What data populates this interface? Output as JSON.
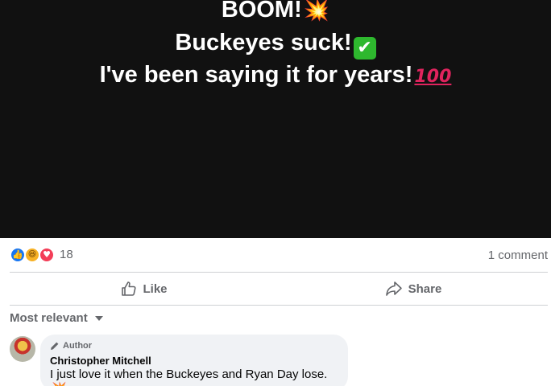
{
  "post": {
    "line1": "BOOM!",
    "line2": "Buckeyes suck!",
    "line3": "I've been saying it for years!",
    "emoji_boom": "💥",
    "emoji_check": "✔",
    "emoji_100": "100"
  },
  "reactions": {
    "count": "18",
    "icons": [
      "like-icon",
      "haha-icon",
      "love-icon"
    ],
    "comments_label": "1 comment"
  },
  "actions": {
    "like_label": "Like",
    "share_label": "Share"
  },
  "sort": {
    "label": "Most relevant"
  },
  "comment": {
    "badge": "Author",
    "name": "Christopher Mitchell",
    "text": "I just love it when the Buckeyes and Ryan Day lose.",
    "emoji": "💥"
  },
  "colors": {
    "post_background": "#111111",
    "like_blue": "#1877f2",
    "love_red": "#f33e58",
    "haha_yellow": "#f7b125",
    "muted_text": "#65676b",
    "bubble_bg": "#f0f2f5"
  }
}
